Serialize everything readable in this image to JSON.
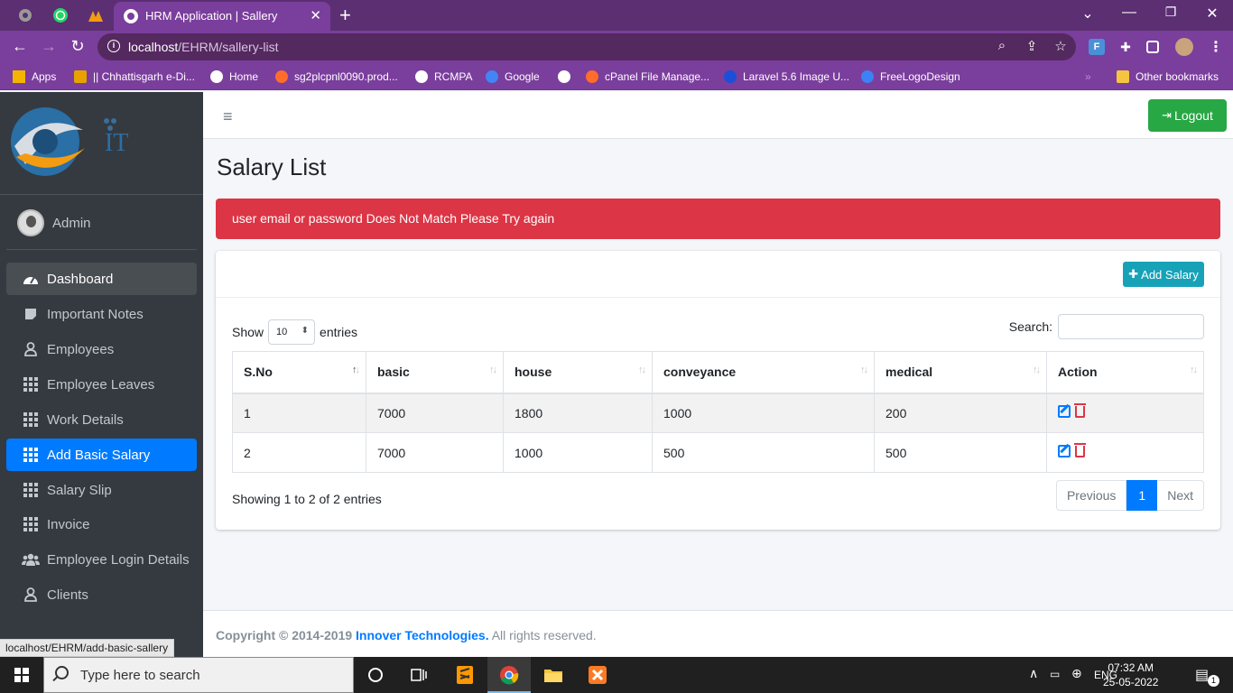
{
  "browser": {
    "tab_title": "HRM Application | Sallery",
    "url_host": "localhost",
    "url_path": "/EHRM/sallery-list",
    "status_url": "localhost/EHRM/add-basic-sallery",
    "bookmarks": [
      {
        "label": "Apps",
        "color": "#f4b400"
      },
      {
        "label": "|| Chhattisgarh e-Di...",
        "color": "#e8a200"
      },
      {
        "label": "Home",
        "color": "#ffffff"
      },
      {
        "label": "sg2plcpnl0090.prod...",
        "color": "#ff6c2c"
      },
      {
        "label": "RCMPA",
        "color": "#ffffff"
      },
      {
        "label": "Google",
        "color": "#4285f4"
      },
      {
        "label": "cPanel File Manage...",
        "color": "#ff6c2c"
      },
      {
        "label": "Laravel 5.6 Image U...",
        "color": "#1d4ed8"
      },
      {
        "label": "FreeLogoDesign",
        "color": "#3b82f6"
      }
    ],
    "other_bookmarks": "Other bookmarks"
  },
  "sidebar": {
    "user_name": "Admin",
    "items": [
      {
        "label": "Dashboard",
        "icon": "dashboard-icon"
      },
      {
        "label": "Important Notes",
        "icon": "note-icon"
      },
      {
        "label": "Employees",
        "icon": "user-icon"
      },
      {
        "label": "Employee Leaves",
        "icon": "grid-icon"
      },
      {
        "label": "Work Details",
        "icon": "grid-icon"
      },
      {
        "label": "Add Basic Salary",
        "icon": "grid-icon"
      },
      {
        "label": "Salary Slip",
        "icon": "grid-icon"
      },
      {
        "label": "Invoice",
        "icon": "grid-icon"
      },
      {
        "label": "Employee Login Details",
        "icon": "users-icon"
      },
      {
        "label": "Clients",
        "icon": "user-icon"
      }
    ]
  },
  "header": {
    "logout_label": "Logout"
  },
  "main": {
    "title": "Salary List",
    "alert": "user email or password Does Not Match Please Try again",
    "add_button": "Add Salary",
    "show_label": "Show",
    "entries_value": "10",
    "entries_label": "entries",
    "search_label": "Search:",
    "search_value": "",
    "columns": [
      "S.No",
      "basic",
      "house",
      "conveyance",
      "medical",
      "Action"
    ],
    "rows": [
      [
        "1",
        "7000",
        "1800",
        "1000",
        "200"
      ],
      [
        "2",
        "7000",
        "1000",
        "500",
        "500"
      ]
    ],
    "info": "Showing 1 to 2 of 2 entries",
    "pager": {
      "previous": "Previous",
      "current": "1",
      "next": "Next"
    }
  },
  "footer": {
    "prefix": "Copyright © 2014-2019",
    "brand": "Innover Technologies.",
    "suffix": "All rights reserved."
  },
  "taskbar": {
    "search_placeholder": "Type here to search",
    "lang": "ENG",
    "time": "07:32 AM",
    "date": "25-05-2022",
    "notif_count": "1"
  },
  "colors": {
    "browser_purple": "#7a3e9c",
    "sidebar_bg": "#343a40",
    "active_blue": "#007bff",
    "alert_red": "#dc3545",
    "logout_green": "#28a745",
    "add_teal": "#17a2b8"
  }
}
